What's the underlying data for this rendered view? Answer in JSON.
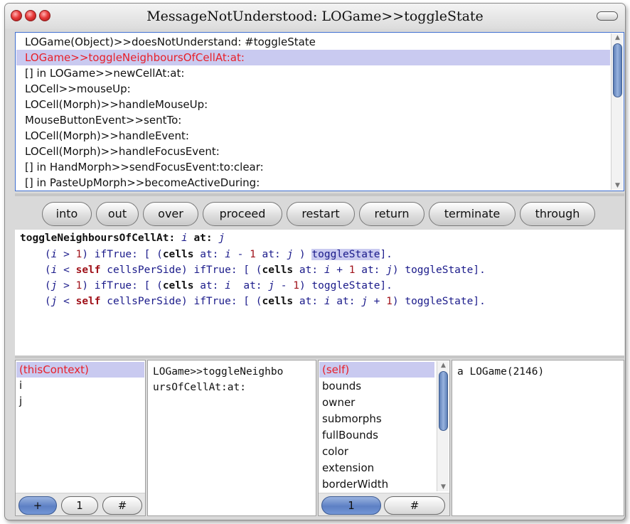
{
  "window": {
    "title": "MessageNotUnderstood: LOGame>>toggleState"
  },
  "stack": {
    "items": [
      "LOGame(Object)>>doesNotUnderstand: #toggleState",
      "LOGame>>toggleNeighboursOfCellAt:at:",
      "[] in LOGame>>newCellAt:at:",
      "LOCell>>mouseUp:",
      "LOCell(Morph)>>handleMouseUp:",
      "MouseButtonEvent>>sentTo:",
      "LOCell(Morph)>>handleEvent:",
      "LOCell(Morph)>>handleFocusEvent:",
      "[] in HandMorph>>sendFocusEvent:to:clear:",
      "[] in PasteUpMorph>>becomeActiveDuring:"
    ],
    "selected_index": 1
  },
  "buttons": {
    "into": "into",
    "out": "out",
    "over": "over",
    "proceed": "proceed",
    "restart": "restart",
    "return": "return",
    "terminate": "terminate",
    "through": "through"
  },
  "code": {
    "l0_sel": "toggleNeighboursOfCellAt:",
    "l0_i": "i",
    "l0_at": "at:",
    "l0_j": "j",
    "l1_a": "    (",
    "l1_i": "i",
    "l1_b": " > ",
    "l1_n": "1",
    "l1_c": ") ifTrue: [ (",
    "l1_cells": "cells",
    "l1_d": " at: ",
    "l1_i2": "i",
    "l1_e": " - ",
    "l1_n2": "1",
    "l1_f": " at: ",
    "l1_j": "j",
    "l1_g": " ) ",
    "l1_toggle": "toggleState",
    "l1_h": "].",
    "l2_a": "    (",
    "l2_i": "i",
    "l2_b": " < ",
    "l2_self": "self",
    "l2_c": " cellsPerSide) ifTrue: [ (",
    "l2_cells": "cells",
    "l2_d": " at: ",
    "l2_i2": "i",
    "l2_e": " + ",
    "l2_n": "1",
    "l2_f": " at: ",
    "l2_j": "j",
    "l2_g": ") toggleState].",
    "l3_a": "    (",
    "l3_j": "j",
    "l3_b": " > ",
    "l3_n": "1",
    "l3_c": ") ifTrue: [ (",
    "l3_cells": "cells",
    "l3_d": " at: ",
    "l3_i": "i",
    "l3_e": "  at: ",
    "l3_j2": "j",
    "l3_f": " - ",
    "l3_n2": "1",
    "l3_g": ") toggleState].",
    "l4_a": "    (",
    "l4_j": "j",
    "l4_b": " < ",
    "l4_self": "self",
    "l4_c": " cellsPerSide) ifTrue: [ (",
    "l4_cells": "cells",
    "l4_d": " at: ",
    "l4_i": "i",
    "l4_e": " at: ",
    "l4_j2": "j",
    "l4_f": " + ",
    "l4_n": "1",
    "l4_g": ") toggleState]."
  },
  "context": {
    "items": [
      "(thisContext)",
      "i",
      "j"
    ],
    "value_line1": "LOGame>>toggleNeighbo",
    "value_line2": "ursOfCellAt:at:",
    "btn_plus": "+",
    "btn_one": "1",
    "btn_hash": "#"
  },
  "receiver": {
    "items": [
      "(self)",
      "bounds",
      "owner",
      "submorphs",
      "fullBounds",
      "color",
      "extension",
      "borderWidth"
    ],
    "value": "a LOGame(2146)",
    "btn_one": "1",
    "btn_hash": "#"
  },
  "colors": {
    "selection": "#c9caf0",
    "selected_text": "#e8202a",
    "focus_border": "#3f6fd0"
  }
}
